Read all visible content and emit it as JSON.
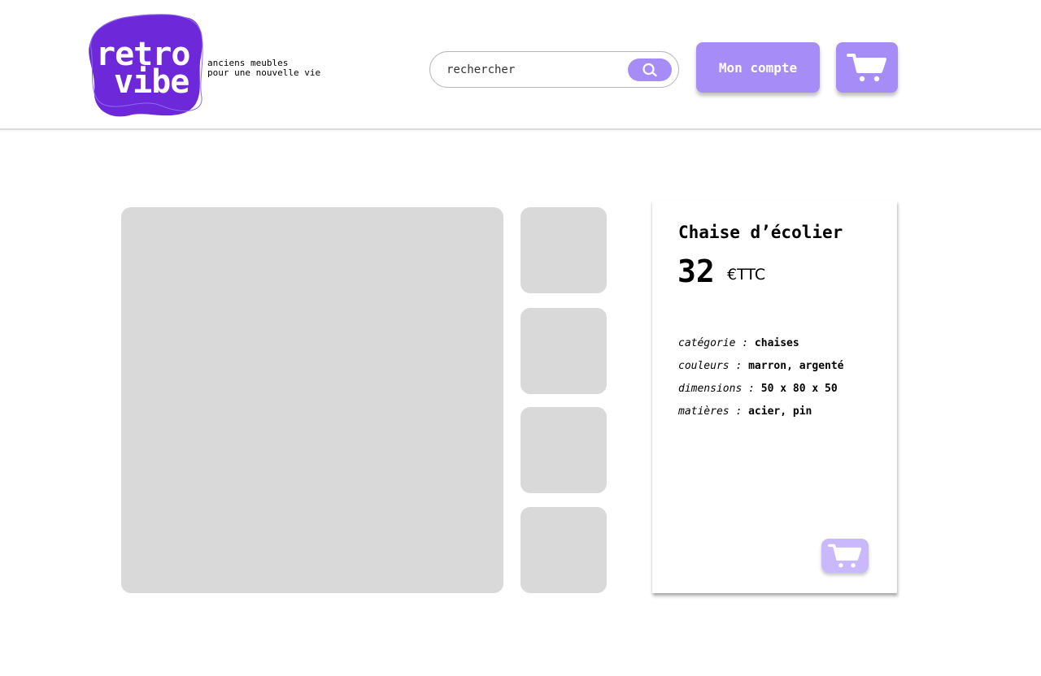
{
  "header": {
    "logo": {
      "line1": "retro",
      "line2": "vibe"
    },
    "tagline": {
      "line1": "anciens meubles",
      "line2": "pour une nouvelle vie"
    },
    "search": {
      "placeholder": "rechercher",
      "icon": "search-icon"
    },
    "account_label": "Mon compte",
    "cart_icon": "cart-icon"
  },
  "product": {
    "name": "Chaise d’écolier",
    "price": "32",
    "price_unit": "€TTC",
    "specs": [
      {
        "label": "catégorie :",
        "value": "chaises"
      },
      {
        "label": "couleurs :",
        "value": "marron, argenté"
      },
      {
        "label": "dimensions :",
        "value": "50 x 80 x 50"
      },
      {
        "label": "matières :",
        "value": "acier, pin"
      }
    ],
    "add_to_cart_icon": "cart-icon"
  },
  "colors": {
    "accent": "#a68cf7",
    "accent_light": "#c9b8fb",
    "logo_blob": "#6d28d9",
    "placeholder": "#d9d9d9"
  }
}
